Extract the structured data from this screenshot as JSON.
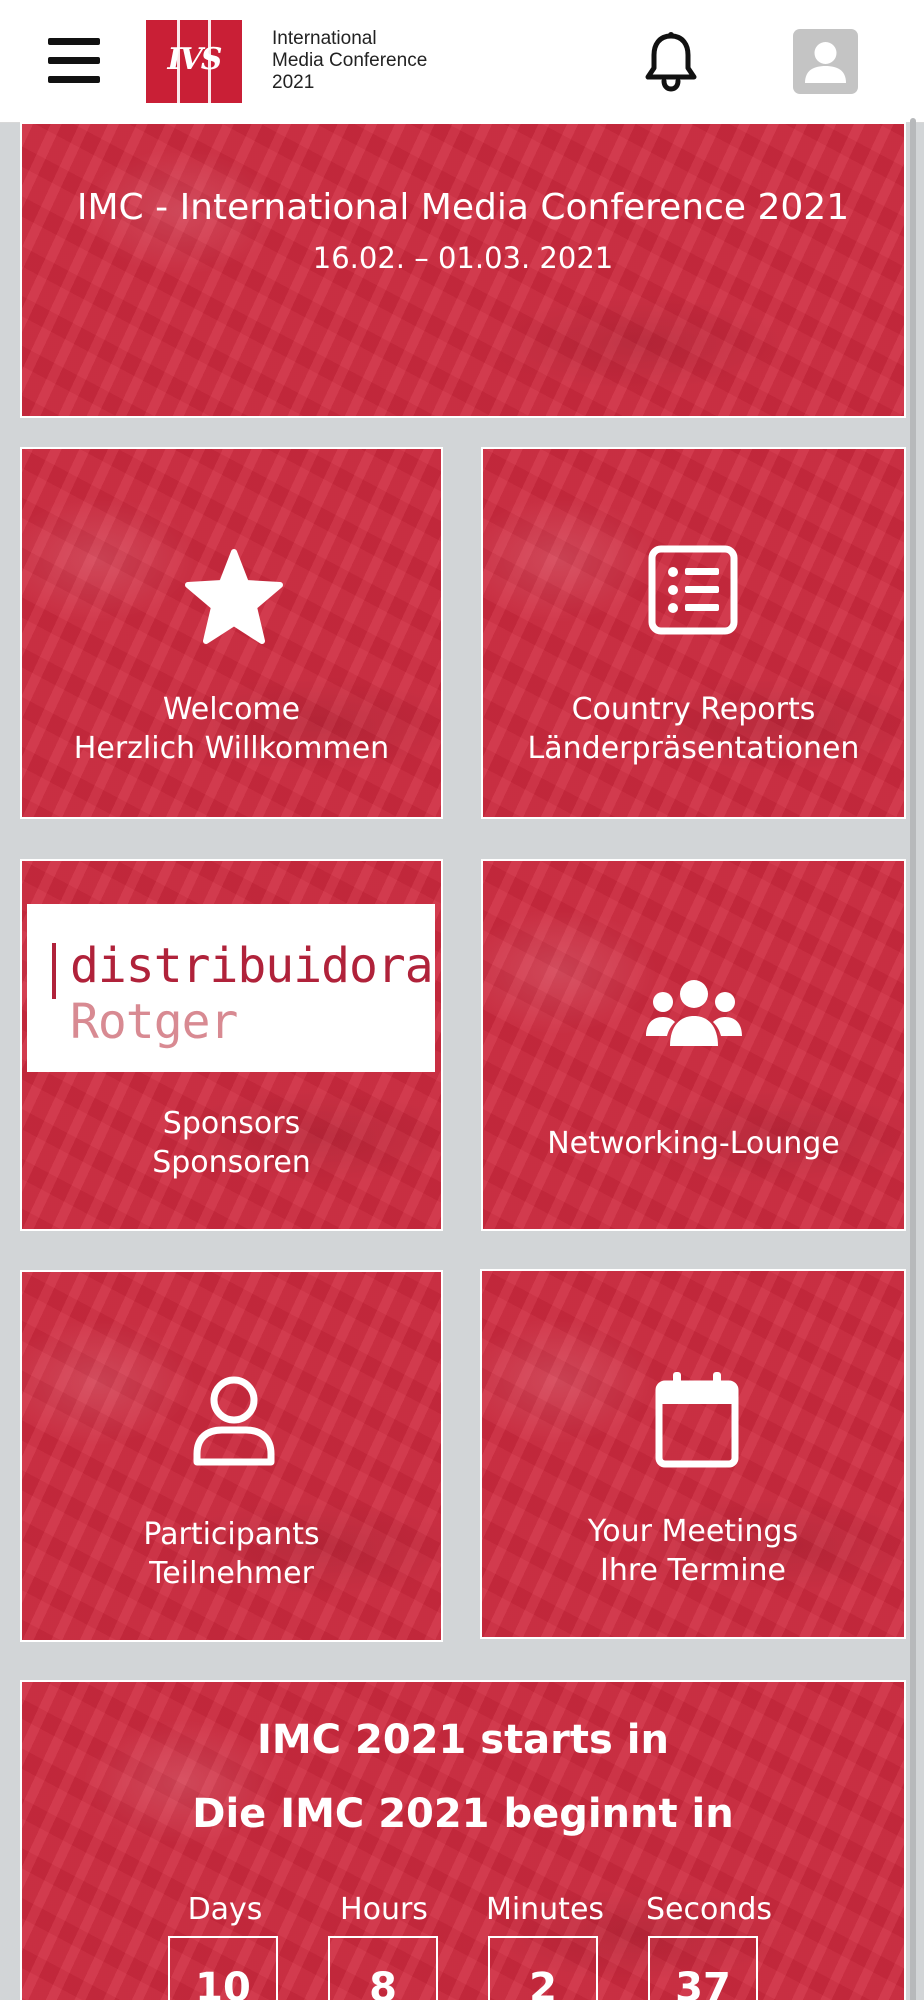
{
  "header": {
    "brand_line1": "International",
    "brand_line2": "Media Conference",
    "brand_line3": "2021",
    "menu_icon": "hamburger-menu-icon",
    "notifications_icon": "bell-icon",
    "profile_icon": "user-avatar-icon"
  },
  "hero": {
    "title": "IMC - International Media Conference 2021",
    "dates": "16.02. – 01.03. 2021"
  },
  "tiles": [
    {
      "line1": "Welcome",
      "line2": "Herzlich Willkommen",
      "icon": "star-icon"
    },
    {
      "line1": "Country Reports",
      "line2": "Länderpräsentationen",
      "icon": "list-icon"
    },
    {
      "line1": "Sponsors",
      "line2": "Sponsoren",
      "icon": "sponsor-logo"
    },
    {
      "line1": "Networking-Lounge",
      "line2": "",
      "icon": "users-group-icon"
    },
    {
      "line1": "Participants",
      "line2": "Teilnehmer",
      "icon": "user-outline-icon"
    },
    {
      "line1": "Your Meetings",
      "line2": "Ihre Termine",
      "icon": "calendar-icon"
    }
  ],
  "sponsor": {
    "line1": "distribuidora",
    "line2": "Rotger"
  },
  "countdown": {
    "title_en": "IMC 2021 starts in",
    "title_de": "Die IMC 2021 beginnt in",
    "units": [
      {
        "label": "Days",
        "value": "10"
      },
      {
        "label": "Hours",
        "value": "8"
      },
      {
        "label": "Minutes",
        "value": "2"
      },
      {
        "label": "Seconds",
        "value": "37"
      }
    ]
  },
  "colors": {
    "primary_red": "#cf2a3f",
    "background": "#d2d5d7",
    "header_bg": "#ffffff"
  }
}
